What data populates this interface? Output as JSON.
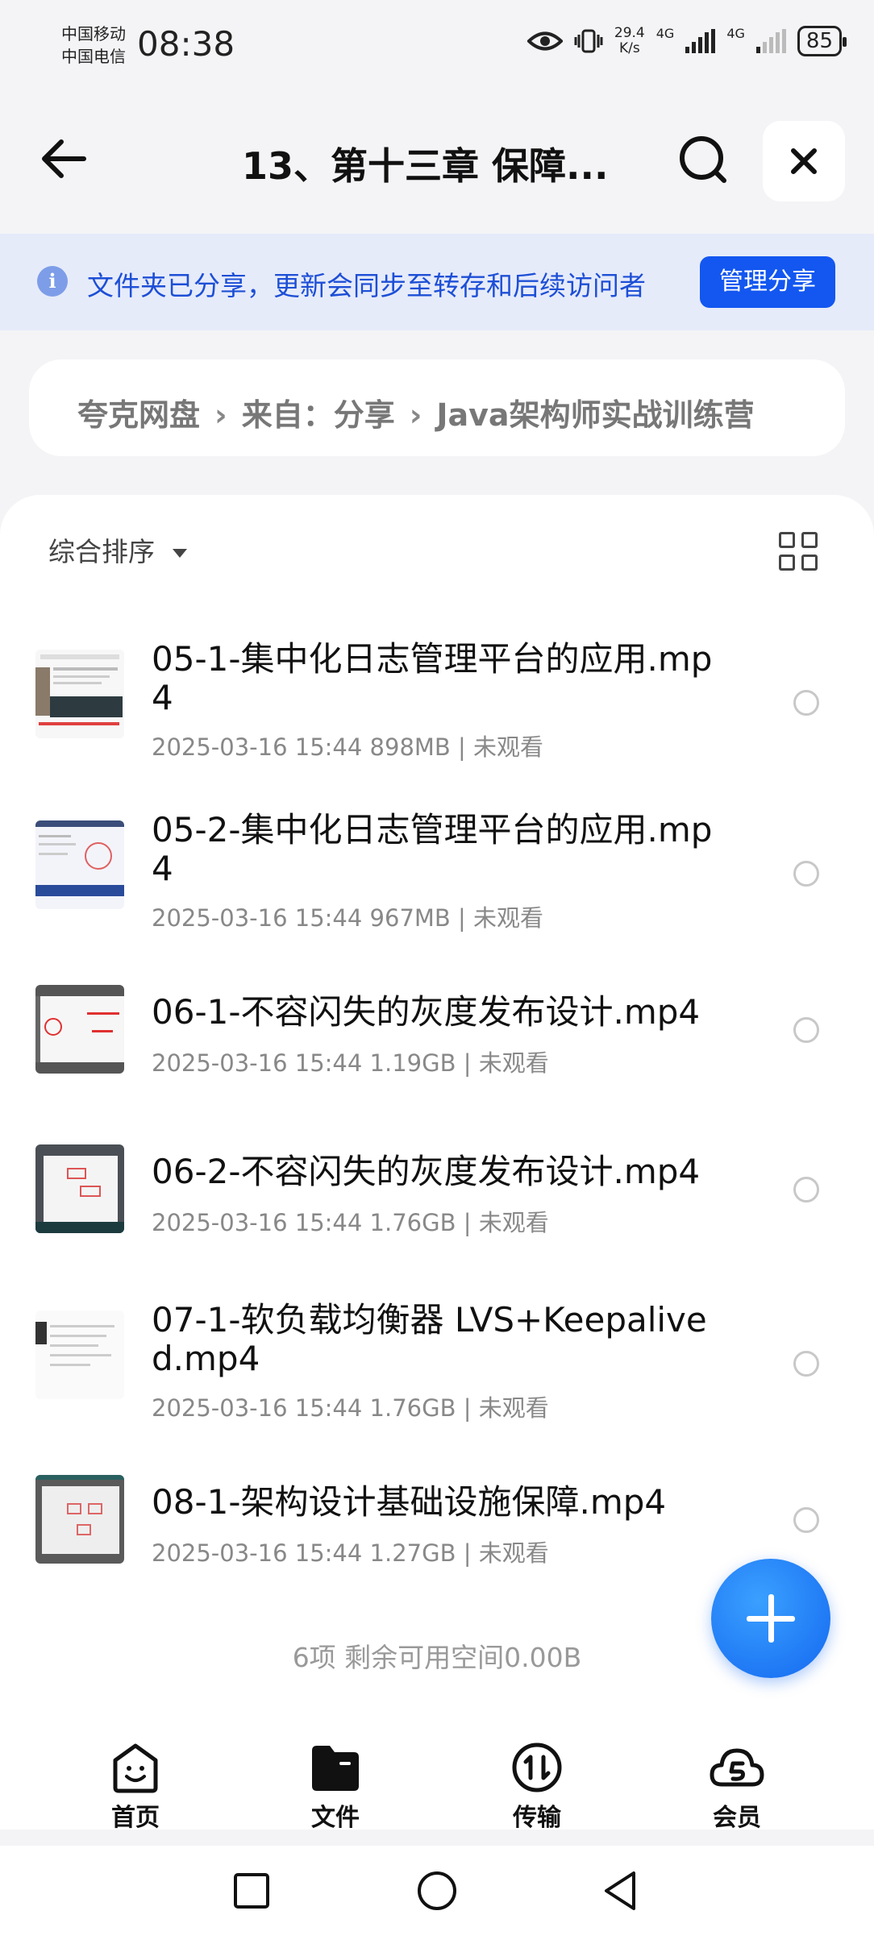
{
  "status_bar": {
    "carrier_1": "中国移动",
    "carrier_2": "中国电信",
    "time": "08:38",
    "speed_value": "29.4",
    "speed_unit": "K/s",
    "network_1": "4G",
    "network_2": "4G",
    "battery": "85"
  },
  "header": {
    "title": "13、第十三章 保障..."
  },
  "share_banner": {
    "text": "文件夹已分享，更新会同步至转存和后续访问者",
    "button": "管理分享"
  },
  "breadcrumb": {
    "items": [
      "夸克网盘",
      "来自：分享",
      "Java架构师实战训练营"
    ]
  },
  "toolbar": {
    "sort_label": "综合排序"
  },
  "files": [
    {
      "name": "05-1-集中化日志管理平台的应用.mp4",
      "meta": "2025-03-16 15:44  898MB | 未观看"
    },
    {
      "name": "05-2-集中化日志管理平台的应用.mp4",
      "meta": "2025-03-16 15:44  967MB | 未观看"
    },
    {
      "name": "06-1-不容闪失的灰度发布设计.mp4",
      "meta": "2025-03-16 15:44  1.19GB | 未观看"
    },
    {
      "name": "06-2-不容闪失的灰度发布设计.mp4",
      "meta": "2025-03-16 15:44  1.76GB | 未观看"
    },
    {
      "name": "07-1-软负载均衡器 LVS+Keepalived.mp4",
      "meta": "2025-03-16 15:44  1.76GB | 未观看"
    },
    {
      "name": "08-1-架构设计基础设施保障.mp4",
      "meta": "2025-03-16 15:44  1.27GB | 未观看"
    }
  ],
  "footer": {
    "count_text": "6项 剩余可用空间0.00B"
  },
  "bottom_nav": {
    "items": [
      "首页",
      "文件",
      "传输",
      "会员"
    ]
  },
  "colors": {
    "accent": "#1357f0",
    "banner_bg": "#e6ebfa",
    "banner_text": "#1d4fd6"
  }
}
